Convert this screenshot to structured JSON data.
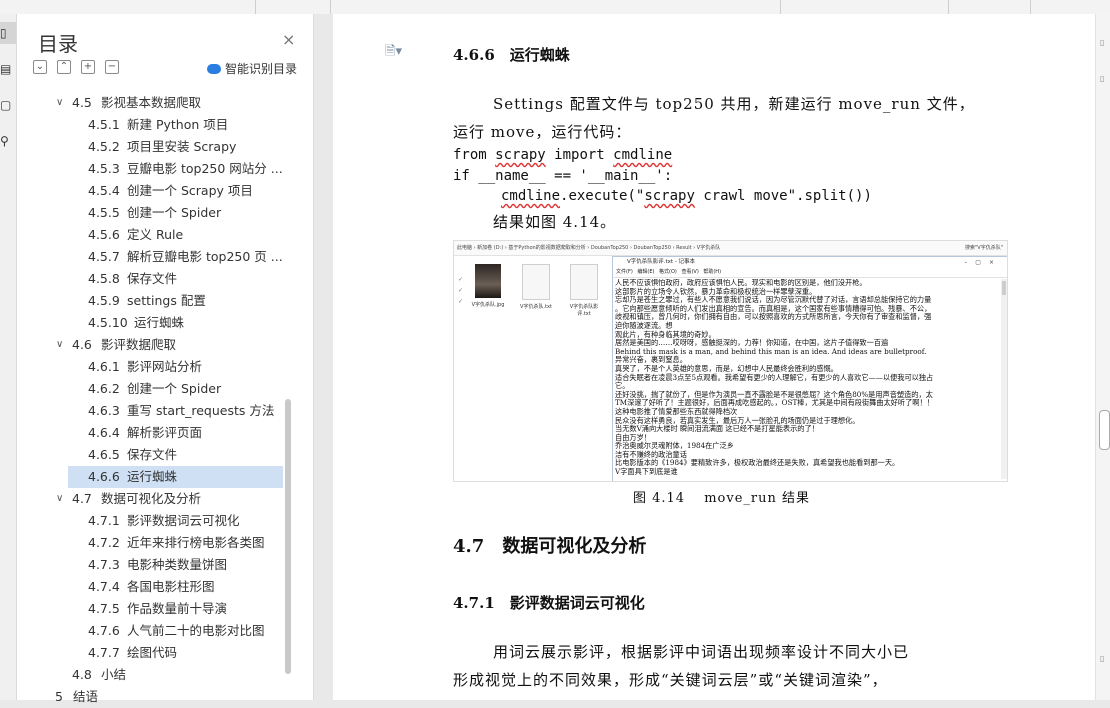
{
  "nav": {
    "title": "目录",
    "close_icon": "×",
    "smart_label": "智能识别目录",
    "toc": [
      {
        "num": "4.5",
        "label": "影视基本数据爬取",
        "level": 2,
        "expanded": true
      },
      {
        "num": "4.5.1",
        "label": "新建 Python 项目",
        "level": 3
      },
      {
        "num": "4.5.2",
        "label": "项目里安装 Scrapy",
        "level": 3
      },
      {
        "num": "4.5.3",
        "label": "豆瓣电影 top250 网站分 ...",
        "level": 3
      },
      {
        "num": "4.5.4",
        "label": "创建一个 Scrapy 项目",
        "level": 3
      },
      {
        "num": "4.5.5",
        "label": "创建一个 Spider",
        "level": 3
      },
      {
        "num": "4.5.6",
        "label": "定义 Rule",
        "level": 3
      },
      {
        "num": "4.5.7",
        "label": "解析豆瓣电影 top250 页 ...",
        "level": 3
      },
      {
        "num": "4.5.8",
        "label": "保存文件",
        "level": 3
      },
      {
        "num": "4.5.9",
        "label": "settings 配置",
        "level": 3
      },
      {
        "num": "4.5.10",
        "label": "运行蜘蛛",
        "level": 3
      },
      {
        "num": "4.6",
        "label": "影评数据爬取",
        "level": 2,
        "expanded": true
      },
      {
        "num": "4.6.1",
        "label": "影评网站分析",
        "level": 3
      },
      {
        "num": "4.6.2",
        "label": "创建一个 Spider",
        "level": 3
      },
      {
        "num": "4.6.3",
        "label": "重写 start_requests 方法",
        "level": 3
      },
      {
        "num": "4.6.4",
        "label": "解析影评页面",
        "level": 3
      },
      {
        "num": "4.6.5",
        "label": "保存文件",
        "level": 3
      },
      {
        "num": "4.6.6",
        "label": "运行蜘蛛",
        "level": 3,
        "selected": true
      },
      {
        "num": "4.7",
        "label": "数据可视化及分析",
        "level": 2,
        "expanded": true
      },
      {
        "num": "4.7.1",
        "label": "影评数据词云可视化",
        "level": 3
      },
      {
        "num": "4.7.2",
        "label": "近年来排行榜电影各类图",
        "level": 3
      },
      {
        "num": "4.7.3",
        "label": "电影种类数量饼图",
        "level": 3
      },
      {
        "num": "4.7.4",
        "label": "各国电影柱形图",
        "level": 3
      },
      {
        "num": "4.7.5",
        "label": "作品数量前十导演",
        "level": 3
      },
      {
        "num": "4.7.6",
        "label": "人气前二十的电影对比图",
        "level": 3
      },
      {
        "num": "4.7.7",
        "label": "绘图代码",
        "level": 3
      },
      {
        "num": "4.8",
        "label": "小结",
        "level": 2
      },
      {
        "num": "5",
        "label": "结语",
        "level": 1
      }
    ]
  },
  "doc": {
    "h_466": "4.6.6　运行蜘蛛",
    "para1_line1": "Settings 配置文件与 top250 共用，新建运行 move_run 文件，",
    "para1_line2": "运行 move，运行代码：",
    "code1_a": "from ",
    "code1_b": "scrapy",
    "code1_c": " import ",
    "code1_d": "cmdline",
    "code2": "if __name__ == '__main__':",
    "code3_a": "cmdline",
    "code3_b": ".execute(\"",
    "code3_c": "scrapy",
    "code3_d": " crawl move\".split())",
    "result_line": "结果如图 4.14。",
    "caption": "图 4.14　 move_run 结果",
    "h_47": "4.7　数据可视化及分析",
    "h_471": "4.7.1　影评数据词云可视化",
    "para2_line1": "用词云展示影评，根据影评中词语出现频率设计不同大小已",
    "para2_line2": "形成视觉上的不同效果，形成“关键词云层”或“关键词渲染”，"
  },
  "screenshot": {
    "path": "此电脑 › 新加卷 (D:) › 基于Python的影视数据爬取和分析 › DoubanTop250 › DoubanTop250 › Result › V字仇杀队",
    "search": "搜索\"V字仇杀队\"",
    "files": [
      "V字仇杀队.jpg",
      "V字仇杀队.txt",
      "V字仇杀队影评.txt"
    ],
    "notepad_title": "V字仇杀队影评.txt - 记事本",
    "notepad_menu": "文件(F) 编辑(E) 格式(O) 查看(V) 帮助(H)",
    "lines": [
      "人民不应该惧怕政府，政府应该惧怕人民。现实和电影的区别是，他们没开枪。",
      "这部影片的立场令人钦然，暴力革命和极权统治一样罪孽深重。",
      "忘却乃是苍生之罪过，有些人不愿意我们说话，因为尽管沉默代替了对话，言语却总能保持它的力量",
      "。它向那些愿意倾听的人们发出真相的宣告。而真相是，这个国家有些事情糟得可怕。残暴、不公，",
      "歧视和镇压，曾几何时，你们拥有自由，可以按照喜欢的方式所思所言，今天你有了审查和监督，强",
      "迫你随波逐流。想",
      "观此片，有种身临其境的奇妙。",
      "居然是美国的……哎呀呀，感触挺深的，力荐！你知道，在中国，这片子值得致一百遍",
      "Behind this mask is a man, and behind this man is an idea. And ideas are bulletproof.",
      "异常兴奋，裹到窒息。",
      "真哭了，不是个人英雄的意思，而是，幻想中人民最终会胜利的感慨。",
      "适合失眠者在凌晨3点至5点观看。我希望有更少的人理解它，有更少的人喜欢它——以便我可以独占",
      "它。",
      "还好没挑，揣了就份了，但是作为演员一直不露脸是不是很憋屈？这个角色80%是用声音塑造的，太",
      "TM深邃了好听了！主题很好，后面再成吃感起的。，OST棒，尤其是中间有段街舞曲太好听了啊！！",
      "这种电影推了情爱那些东西就得降档次",
      "民众没有这样勇良，若真实发生，最后万人一张脸孔的场面仍是过于理想化。",
      "当无数V涌向大楼时 瞬间泪流满面 这已经不是打星能表示的了！",
      "自由万岁！",
      "乔治奥威尔灵魂附体，1984在广泛乡",
      "洁有不赚终的政治童话",
      "比电影版本的《1984》要精致许多，极权政治最终还是失败，真希望我也能看到那一天。",
      "V字面具下到底是谁"
    ]
  }
}
